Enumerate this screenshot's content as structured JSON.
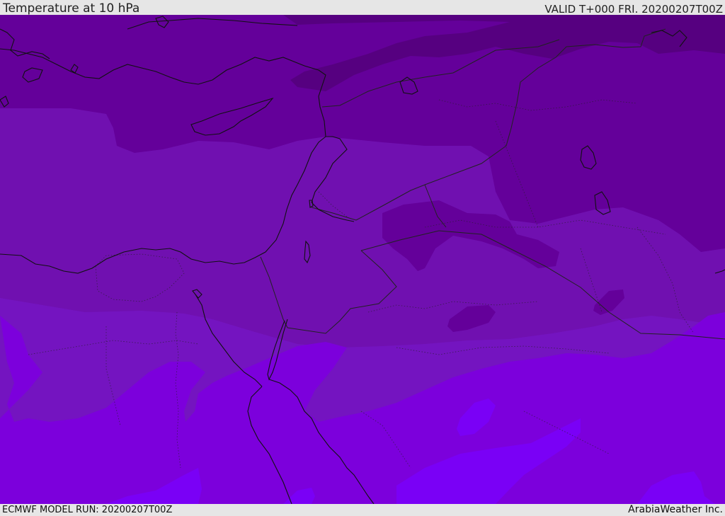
{
  "header": {
    "title": "Temperature at 10 hPa",
    "valid": "VALID T+000 FRI. 20200207T00Z"
  },
  "footer": {
    "model_run": "ECMWF MODEL RUN: 20200207T00Z",
    "credit": "ArabiaWeather Inc."
  },
  "colors": {
    "band_darkest": "#560080",
    "band_dark": "#64009a",
    "band_mid": "#7010b0",
    "band_lower": "#7414c0",
    "band_violet": "#7c00dc",
    "band_bright": "#7a00f6",
    "coast_line": "#111111",
    "border_line": "#222222"
  }
}
